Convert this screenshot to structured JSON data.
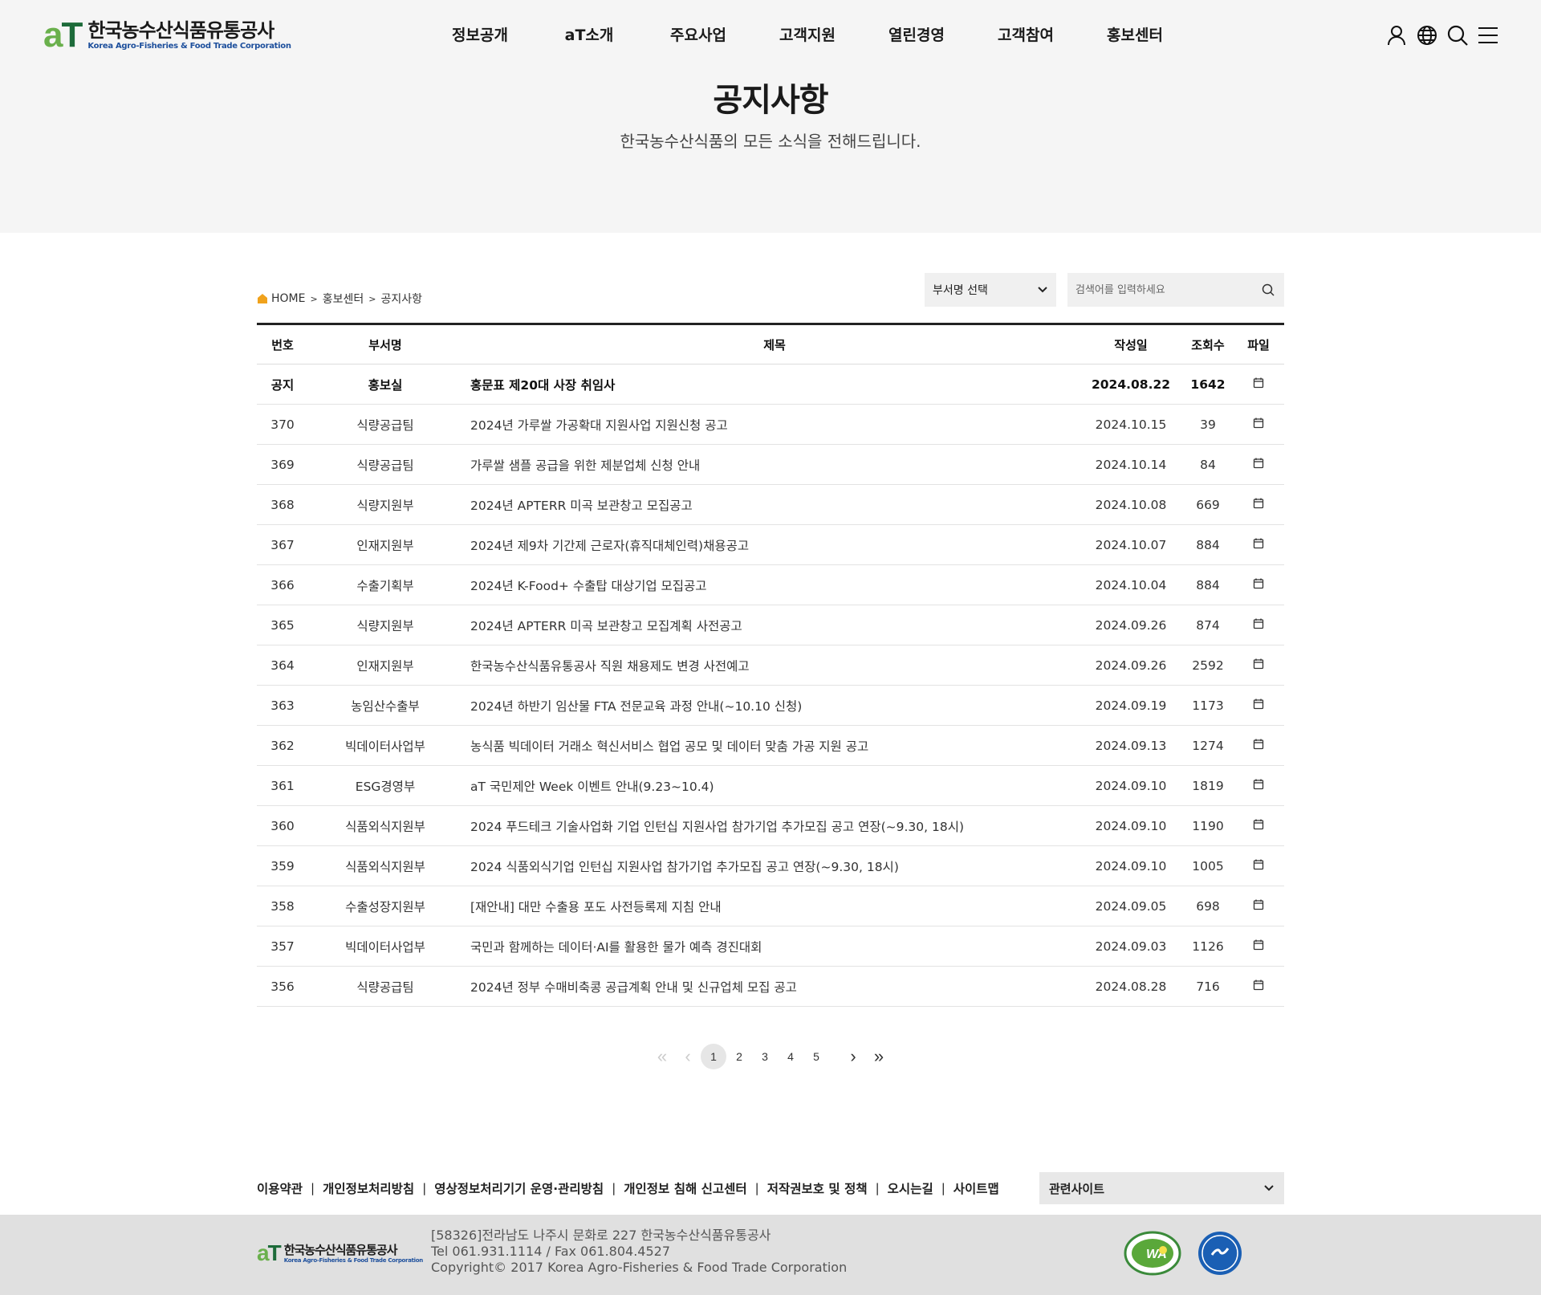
{
  "header": {
    "logo_ko": "한국농수산식품유통공사",
    "logo_en": "Korea Agro-Fisheries & Food Trade Corporation",
    "logo_mark_a": "a",
    "logo_mark_t": "T",
    "nav": [
      "정보공개",
      "aT소개",
      "주요사업",
      "고객지원",
      "열린경영",
      "고객참여",
      "홍보센터"
    ],
    "icons": [
      "user-icon",
      "globe-icon",
      "search-icon",
      "menu-icon"
    ]
  },
  "hero": {
    "title": "공지사항",
    "subtitle": "한국농수산식품의 모든 소식을 전해드립니다."
  },
  "breadcrumb": {
    "home": "HOME",
    "level1": "홍보센터",
    "level2": "공지사항"
  },
  "filters": {
    "dept_select": "부서명 선택",
    "search_placeholder": "검색어를 입력하세요"
  },
  "table": {
    "headers": {
      "no": "번호",
      "dept": "부서명",
      "title": "제목",
      "date": "작성일",
      "views": "조회수",
      "file": "파일"
    },
    "rows": [
      {
        "no": "공지",
        "dept": "홍보실",
        "title": "홍문표 제20대 사장 취임사",
        "date": "2024.08.22",
        "views": "1642",
        "notice": true
      },
      {
        "no": "370",
        "dept": "식량공급팀",
        "title": "2024년 가루쌀 가공확대 지원사업 지원신청 공고",
        "date": "2024.10.15",
        "views": "39"
      },
      {
        "no": "369",
        "dept": "식량공급팀",
        "title": "가루쌀 샘플 공급을 위한 제분업체 신청 안내",
        "date": "2024.10.14",
        "views": "84"
      },
      {
        "no": "368",
        "dept": "식량지원부",
        "title": "2024년 APTERR 미곡 보관창고 모집공고",
        "date": "2024.10.08",
        "views": "669"
      },
      {
        "no": "367",
        "dept": "인재지원부",
        "title": "2024년 제9차 기간제 근로자(휴직대체인력)채용공고",
        "date": "2024.10.07",
        "views": "884"
      },
      {
        "no": "366",
        "dept": "수출기획부",
        "title": "2024년 K-Food+ 수출탑 대상기업 모집공고",
        "date": "2024.10.04",
        "views": "884"
      },
      {
        "no": "365",
        "dept": "식량지원부",
        "title": "2024년 APTERR 미곡 보관창고 모집계획 사전공고",
        "date": "2024.09.26",
        "views": "874"
      },
      {
        "no": "364",
        "dept": "인재지원부",
        "title": "한국농수산식품유통공사 직원 채용제도 변경 사전예고",
        "date": "2024.09.26",
        "views": "2592"
      },
      {
        "no": "363",
        "dept": "농임산수출부",
        "title": "2024년 하반기 임산물 FTA 전문교육 과정 안내(~10.10 신청)",
        "date": "2024.09.19",
        "views": "1173"
      },
      {
        "no": "362",
        "dept": "빅데이터사업부",
        "title": "농식품 빅데이터 거래소 혁신서비스 협업 공모 및 데이터 맞춤 가공 지원 공고",
        "date": "2024.09.13",
        "views": "1274"
      },
      {
        "no": "361",
        "dept": "ESG경영부",
        "title": "aT 국민제안 Week 이벤트 안내(9.23~10.4)",
        "date": "2024.09.10",
        "views": "1819"
      },
      {
        "no": "360",
        "dept": "식품외식지원부",
        "title": "2024 푸드테크 기술사업화 기업 인턴십 지원사업 참가기업 추가모집 공고 연장(~9.30, 18시)",
        "date": "2024.09.10",
        "views": "1190"
      },
      {
        "no": "359",
        "dept": "식품외식지원부",
        "title": "2024 식품외식기업 인턴십 지원사업 참가기업 추가모집 공고 연장(~9.30, 18시)",
        "date": "2024.09.10",
        "views": "1005"
      },
      {
        "no": "358",
        "dept": "수출성장지원부",
        "title": "[재안내] 대만 수출용 포도 사전등록제 지침 안내",
        "date": "2024.09.05",
        "views": "698"
      },
      {
        "no": "357",
        "dept": "빅데이터사업부",
        "title": "국민과 함께하는 데이터·AI를 활용한 물가 예측 경진대회",
        "date": "2024.09.03",
        "views": "1126"
      },
      {
        "no": "356",
        "dept": "식량공급팀",
        "title": "2024년 정부 수매비축콩 공급계획 안내 및 신규업체 모집 공고",
        "date": "2024.08.28",
        "views": "716"
      }
    ]
  },
  "pagination": {
    "first": "«",
    "prev": "‹",
    "pages": [
      "1",
      "2",
      "3",
      "4",
      "5"
    ],
    "current": "1",
    "next": "›",
    "last": "»"
  },
  "footer": {
    "links": [
      "이용약관",
      "개인정보처리방침",
      "영상정보처리기기 운영·관리방침",
      "개인정보 침해 신고센터",
      "저작권보호 및 정책",
      "오시는길",
      "사이트맵"
    ],
    "related_sites": "관련사이트",
    "address": "[58326]전라남도 나주시 문화로 227 한국농수산식품유통공사",
    "contact": "Tel 061.931.1114 / Fax 061.804.4527",
    "copyright": "Copyright© 2017 Korea Agro-Fisheries & Food Trade Corporation",
    "badge_wa_text": "WA"
  },
  "colors": {
    "logo_a": "#6ab04c",
    "logo_t": "#1d6b3a",
    "logo_en": "#1d4f9c",
    "hero_bg": "#f5f5f5",
    "footer_bg": "#e0e0e0",
    "home_icon": "#f0a21c"
  }
}
